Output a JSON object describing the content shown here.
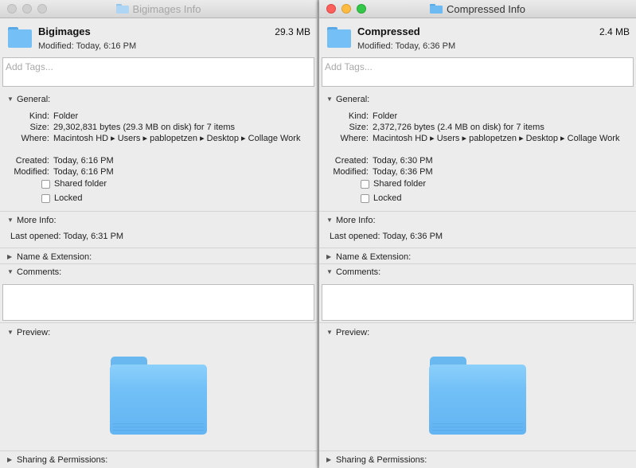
{
  "windows": [
    {
      "title": "Bigimages Info",
      "name": "Bigimages",
      "size": "29.3 MB",
      "modified_header": "Modified: Today, 6:16 PM",
      "tags_placeholder": "Add Tags...",
      "general_label": "General:",
      "kind_k": "Kind:",
      "kind_v": "Folder",
      "size_k": "Size:",
      "size_v": "29,302,831 bytes (29.3 MB on disk) for 7 items",
      "where_k": "Where:",
      "where_v": "Macintosh HD ▸ Users ▸ pablopetzen ▸ Desktop ▸ Collage Work",
      "created_k": "Created:",
      "created_v": "Today, 6:16 PM",
      "modified_k": "Modified:",
      "modified_v": "Today, 6:16 PM",
      "shared_label": "Shared folder",
      "locked_label": "Locked",
      "more_info_label": "More Info:",
      "last_opened": "Last opened: Today, 6:31 PM",
      "name_ext_label": "Name & Extension:",
      "comments_label": "Comments:",
      "preview_label": "Preview:",
      "sharing_label": "Sharing & Permissions:"
    },
    {
      "title": "Compressed Info",
      "name": "Compressed",
      "size": "2.4 MB",
      "modified_header": "Modified: Today, 6:36 PM",
      "tags_placeholder": "Add Tags...",
      "general_label": "General:",
      "kind_k": "Kind:",
      "kind_v": "Folder",
      "size_k": "Size:",
      "size_v": "2,372,726 bytes (2.4 MB on disk) for 7 items",
      "where_k": "Where:",
      "where_v": "Macintosh HD ▸ Users ▸ pablopetzen ▸ Desktop ▸ Collage Work",
      "created_k": "Created:",
      "created_v": "Today, 6:30 PM",
      "modified_k": "Modified:",
      "modified_v": "Today, 6:36 PM",
      "shared_label": "Shared folder",
      "locked_label": "Locked",
      "more_info_label": "More Info:",
      "last_opened": "Last opened: Today, 6:36 PM",
      "name_ext_label": "Name & Extension:",
      "comments_label": "Comments:",
      "preview_label": "Preview:",
      "sharing_label": "Sharing & Permissions:"
    }
  ],
  "icons": {
    "expanded": "disclosure-triangle-down-icon",
    "collapsed": "disclosure-triangle-right-icon",
    "folder": "folder-icon"
  }
}
